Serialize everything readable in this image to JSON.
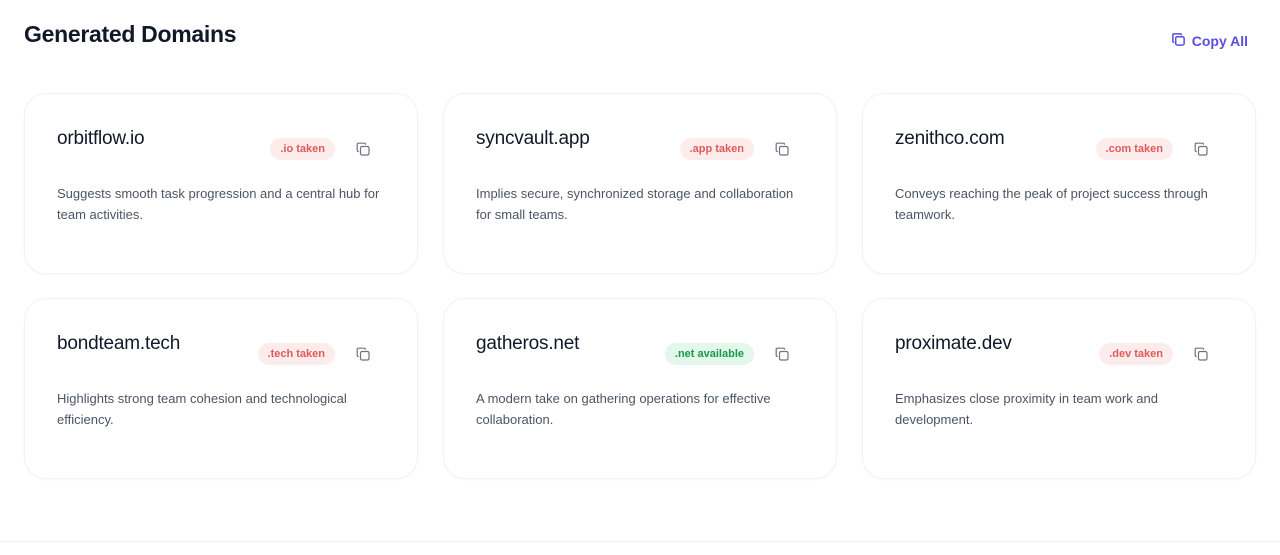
{
  "header": {
    "title": "Generated Domains",
    "copy_all_label": "Copy All"
  },
  "icons": {
    "copy_all": "copy-icon",
    "card_copy": "copy-icon"
  },
  "colors": {
    "accent": "#5b4ee0",
    "taken_bg": "#fdecec",
    "taken_text": "#e05a5a",
    "available_bg": "#e3f7ea",
    "available_text": "#179a4c"
  },
  "domains": [
    {
      "name": "orbitflow.io",
      "status": ".io taken",
      "state": "taken",
      "description": "Suggests smooth task progression and a central hub for team activities."
    },
    {
      "name": "syncvault.app",
      "status": ".app taken",
      "state": "taken",
      "description": "Implies secure, synchronized storage and collaboration for small teams."
    },
    {
      "name": "zenithco.com",
      "status": ".com taken",
      "state": "taken",
      "description": "Conveys reaching the peak of project success through teamwork."
    },
    {
      "name": "bondteam.tech",
      "status": ".tech taken",
      "state": "taken",
      "description": "Highlights strong team cohesion and technological efficiency."
    },
    {
      "name": "gatheros.net",
      "status": ".net available",
      "state": "available",
      "description": "A modern take on gathering operations for effective collaboration."
    },
    {
      "name": "proximate.dev",
      "status": ".dev taken",
      "state": "taken",
      "description": "Emphasizes close proximity in team work and development."
    }
  ]
}
